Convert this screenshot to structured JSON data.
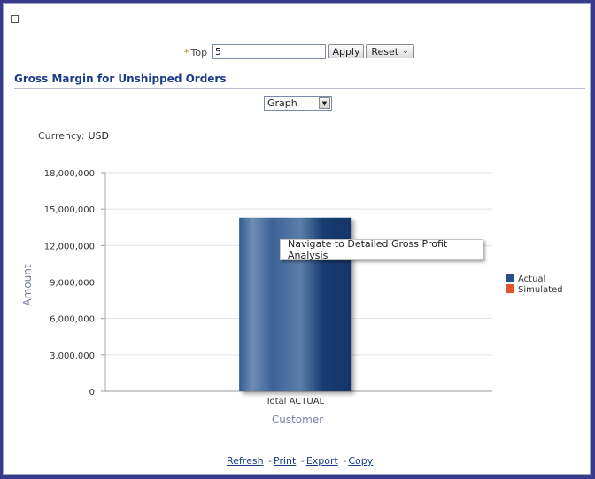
{
  "filter": {
    "top_label": "Top",
    "required_marker": "*",
    "top_value": "5",
    "apply_label": "Apply",
    "reset_label": "Reset"
  },
  "section": {
    "title": "Gross Margin for Unshipped Orders"
  },
  "view": {
    "selected": "Graph"
  },
  "currency": {
    "label": "Currency:",
    "value": "USD"
  },
  "chart_data": {
    "type": "bar",
    "categories": [
      "Total ACTUAL"
    ],
    "series": [
      {
        "name": "Actual",
        "values": [
          14300000
        ],
        "color": "#1f3f72"
      }
    ],
    "legend": [
      {
        "name": "Actual",
        "color": "#2a4e86"
      },
      {
        "name": "Simulated",
        "color": "#e0552a"
      }
    ],
    "xlabel": "Customer",
    "ylabel": "Amount",
    "ylim": [
      0,
      18000000
    ],
    "yticks": [
      "0",
      "3,000,000",
      "6,000,000",
      "9,000,000",
      "12,000,000",
      "15,000,000",
      "18,000,000"
    ],
    "legend_position": "right"
  },
  "tooltip": {
    "text": "Navigate to Detailed Gross Profit Analysis"
  },
  "links": {
    "refresh": "Refresh",
    "print": "Print",
    "export": "Export",
    "copy": "Copy"
  }
}
